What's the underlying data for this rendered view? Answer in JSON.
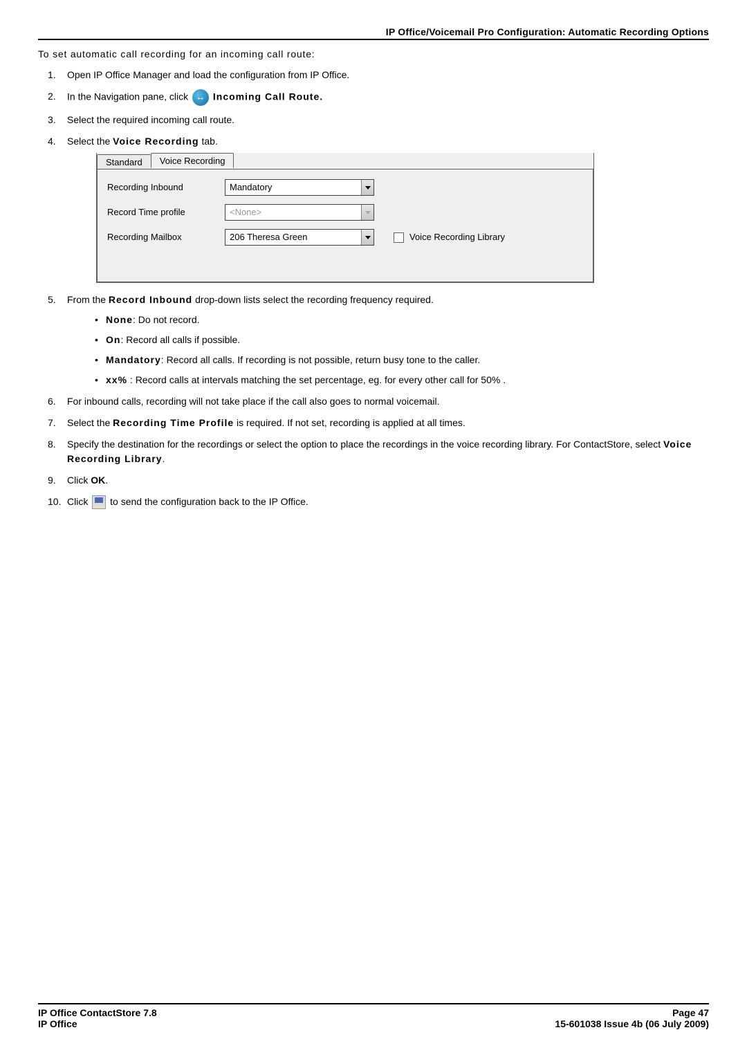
{
  "header": {
    "title": "IP Office/Voicemail Pro Configuration: Automatic Recording Options"
  },
  "intro": "To set automatic call recording for an incoming call route:",
  "steps": {
    "s1": "Open IP Office Manager and load the configuration from IP Office.",
    "s2_prefix": "In the Navigation pane, click ",
    "s2_suffix": " Incoming Call Route.",
    "s3": "Select the required incoming call route.",
    "s4_prefix": "Select the ",
    "s4_bold": "Voice Recording",
    "s4_suffix": " tab.",
    "s5_prefix": "From the ",
    "s5_bold": "Record Inbound",
    "s5_suffix": " drop-down lists select the recording frequency required.",
    "sub": {
      "none_label": "None",
      "none_text": ": Do not record.",
      "on_label": "On",
      "on_text": ": Record all calls if possible.",
      "mand_label": "Mandatory",
      "mand_text": ": Record all calls. If recording is not possible, return busy tone to the caller.",
      "xx_label": "xx%",
      "xx_text": " : Record calls at intervals matching the set percentage, eg. for every other call for 50% ."
    },
    "s6": "For inbound calls, recording will not take place if the call also goes to normal voicemail.",
    "s7_prefix": "Select the ",
    "s7_bold": "Recording Time Profile",
    "s7_suffix": " is required. If not set, recording is applied at all times.",
    "s8_prefix": "Specify the destination for the recordings or select the option to place the recordings in the voice recording library. For ContactStore, select ",
    "s8_bold": "Voice Recording Library",
    "s8_suffix": ".",
    "s9_prefix": "Click ",
    "s9_bold": "OK",
    "s9_suffix": ".",
    "s10_prefix": "Click ",
    "s10_suffix": " to send the configuration back to the IP Office."
  },
  "panel": {
    "tab_standard": "Standard",
    "tab_voice": "Voice Recording",
    "label_inbound": "Recording Inbound",
    "value_inbound": "Mandatory",
    "label_timeprofile": "Record Time profile",
    "value_timeprofile": "<None>",
    "label_mailbox": "Recording Mailbox",
    "value_mailbox": "206 Theresa Green",
    "checkbox_label": "Voice Recording Library"
  },
  "footer": {
    "left1": "IP Office ContactStore 7.8",
    "left2": "IP Office",
    "right1": "Page 47",
    "right2": "15-601038 Issue 4b (06 July 2009)"
  }
}
